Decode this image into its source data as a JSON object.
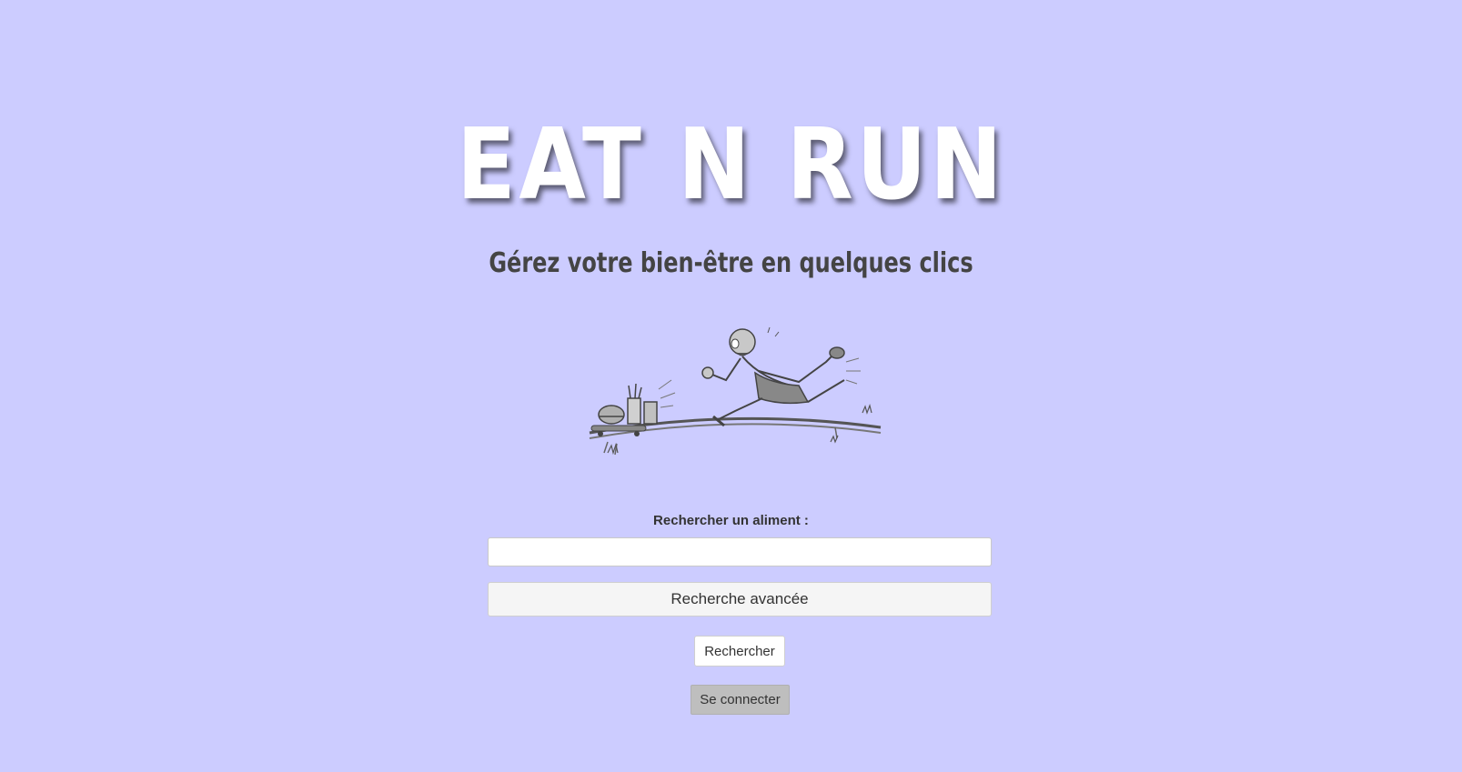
{
  "header": {
    "title": "EAT N RUN",
    "subtitle": "Gérez votre bien-être en quelques clics"
  },
  "illustration": {
    "icon": "running-man-chased-by-fast-food-icon"
  },
  "search": {
    "label": "Rechercher un aliment :",
    "value": "",
    "advanced_label": "Recherche avancée",
    "submit_label": "Rechercher"
  },
  "auth": {
    "login_label": "Se connecter"
  },
  "colors": {
    "background": "#ccccff",
    "title": "#ffffff",
    "subtitle": "#444444",
    "login_button": "#bebebe"
  }
}
